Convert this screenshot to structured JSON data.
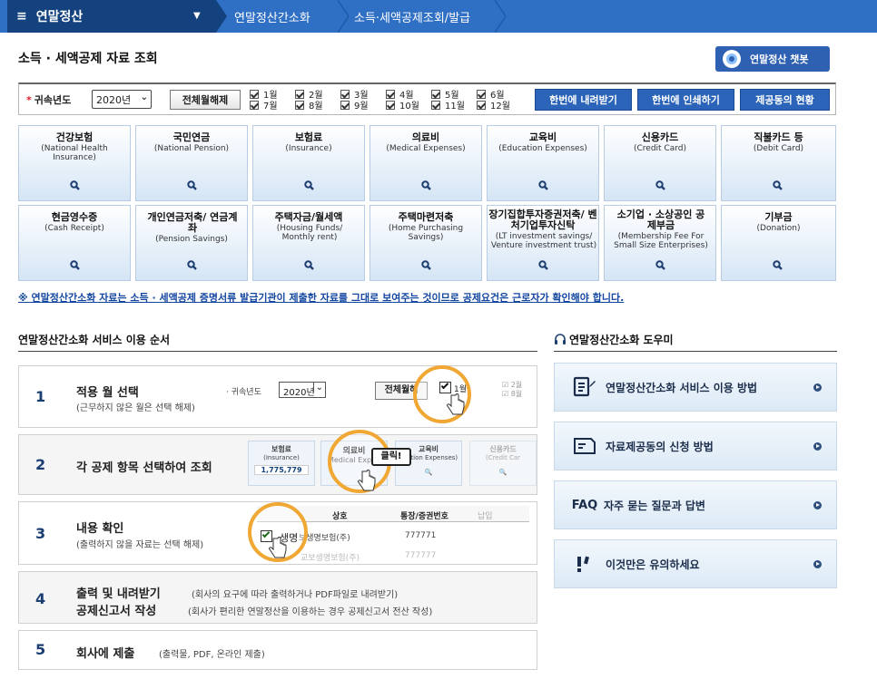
{
  "nav": {
    "menu_title": "연말정산",
    "crumbs": [
      "연말정산간소화",
      "소득·세액공제조회/발급"
    ]
  },
  "page": {
    "title": "소득 · 세액공제 자료 조회",
    "chatbot_label": "연말정산 챗봇"
  },
  "filter": {
    "year_label": "귀속년도",
    "year_value": "2020년",
    "clear_all": "전체월해제",
    "months": [
      "1월",
      "2월",
      "3월",
      "4월",
      "5월",
      "6월",
      "7월",
      "8월",
      "9월",
      "10월",
      "11월",
      "12월"
    ],
    "actions": [
      "한번에 내려받기",
      "한번에 인쇄하기",
      "제공동의 현황"
    ]
  },
  "categories": [
    {
      "name": "건강보험",
      "en": "(National Health Insurance)"
    },
    {
      "name": "국민연금",
      "en": "(National Pension)"
    },
    {
      "name": "보험료",
      "en": "(Insurance)"
    },
    {
      "name": "의료비",
      "en": "(Medical Expenses)"
    },
    {
      "name": "교육비",
      "en": "(Education Expenses)"
    },
    {
      "name": "신용카드",
      "en": "(Credit Card)"
    },
    {
      "name": "직불카드 등",
      "en": "(Debit Card)"
    },
    {
      "name": "현금영수증",
      "en": "(Cash Receipt)"
    },
    {
      "name": "개인연금저축/ 연금계좌",
      "en": "(Pension Savings)"
    },
    {
      "name": "주택자금/월세액",
      "en": "(Housing Funds/ Monthly rent)"
    },
    {
      "name": "주택마련저축",
      "en": "(Home Purchasing Savings)"
    },
    {
      "name": "장기집합투자증권저축/ 벤처기업투자신탁",
      "en": "(LT investment savings/ Venture investment trust)"
    },
    {
      "name": "소기업 · 소상공인 공제부금",
      "en": "(Membership Fee For Small Size Enterprises)"
    },
    {
      "name": "기부금",
      "en": "(Donation)"
    }
  ],
  "notice": "※ 연말정산간소화 자료는 소득 · 세액공제 증명서류 발급기관이 제출한 자료를 그대로 보여주는 것이므로 공제요건은 근로자가 확인해야 합니다.",
  "steps_section": {
    "title": "연말정산간소화 서비스 이용 순서",
    "steps": [
      {
        "num": "1",
        "title": "적용 월 선택",
        "sub": "(근무하지 않은 월은 선택 해제)"
      },
      {
        "num": "2",
        "title": "각 공제 항목 선택하여 조회",
        "sub": ""
      },
      {
        "num": "3",
        "title": "내용 확인",
        "sub": "(출력하지 않을 자료는 선택 해제)"
      },
      {
        "num": "4",
        "title": "출력 및 내려받기",
        "title2": "공제신고서 작성",
        "sub": "(회사의 요구에 따라 출력하거나 PDF파일로 내려받기)",
        "sub2": "(회사가 편리한 연말정산을 이용하는 경우 공제신고서 전산 작성)"
      },
      {
        "num": "5",
        "title": "회사에 제출",
        "sub": "(출력물, PDF, 온라인 제출)"
      }
    ],
    "mock1": {
      "year_label": "귀속년도",
      "year_value": "2020년",
      "clear_btn": "전체월해",
      "m1": "1월",
      "m2": "2월",
      "m8": "8월"
    },
    "mock2": {
      "c1_name": "보험료",
      "c1_en": "(Insurance)",
      "c1_amount": "1,775,779",
      "c2_name": "의료비",
      "c2_en": "Medical Expen",
      "c3_name": "교육비",
      "c3_en": "ucation Expenses)",
      "c4_name": "신용카드",
      "c4_en": "(Credit Car",
      "click": "클릭!"
    },
    "mock3": {
      "h1": "상호",
      "h2": "통장/증권번호",
      "h3": "납입",
      "row_name": "생명",
      "row_company": "보생명보험(주)",
      "row_no": "777771",
      "row2": "교보생명보험(주)",
      "row2_no": "777777"
    }
  },
  "helper_section": {
    "title": "연말정산간소화 도우미",
    "items": [
      {
        "label": "연말정산간소화 서비스 이용 방법"
      },
      {
        "label": "자료제공동의 신청 방법"
      },
      {
        "label": "자주 묻는 질문과 답변",
        "prefix": "FAQ"
      },
      {
        "label": "이것만은 유의하세요"
      }
    ]
  },
  "colors": {
    "nav_blue": "#2f6fc4",
    "nav_dark": "#13427f",
    "button_blue": "#2b64b9",
    "ring_orange": "#f0a733"
  }
}
